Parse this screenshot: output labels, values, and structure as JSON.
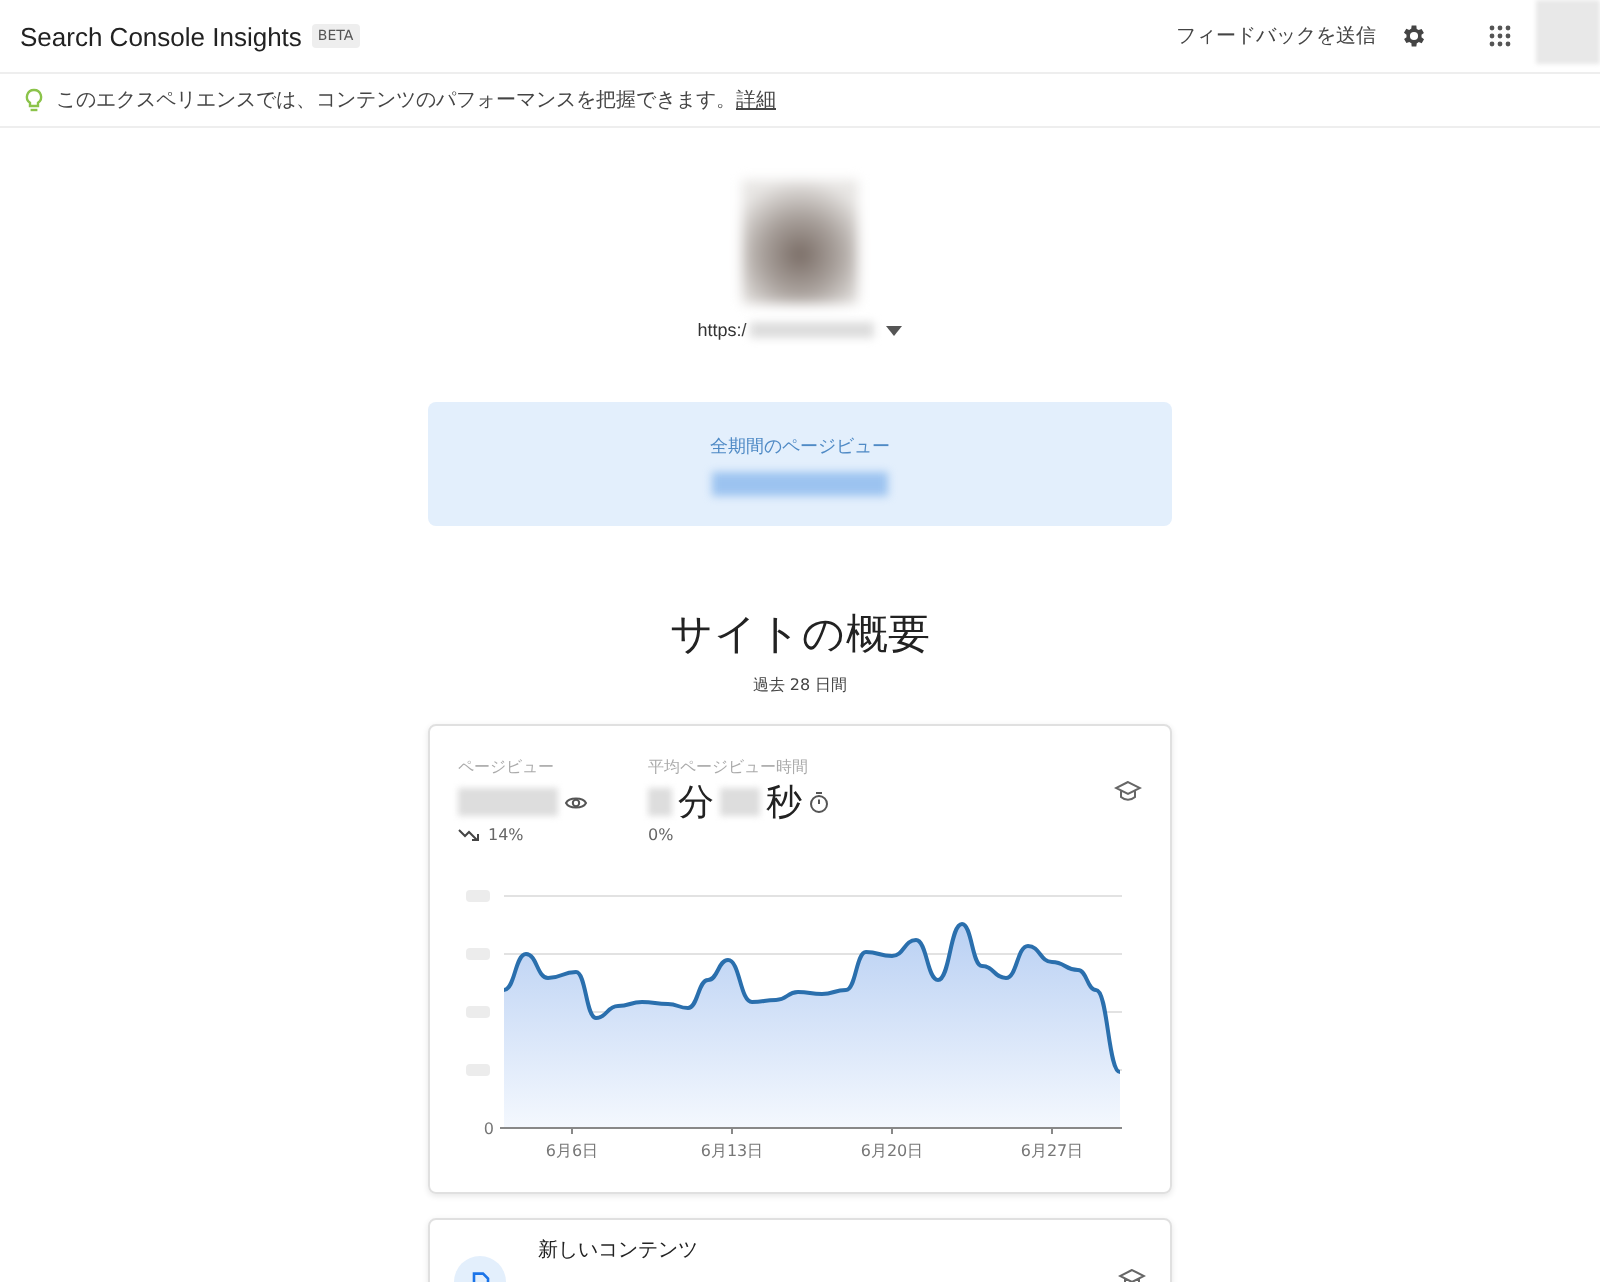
{
  "header": {
    "title": "Search Console Insights",
    "badge": "BETA",
    "feedback": "フィードバックを送信"
  },
  "banner": {
    "text": "このエクスペリエンスでは、コンテンツのパフォーマンスを把握できます。",
    "link": "詳細"
  },
  "property": {
    "url": "https:/"
  },
  "total": {
    "label": "全期間のページビュー"
  },
  "overview": {
    "title": "サイトの概要",
    "subtitle": "過去 28 日間"
  },
  "metrics": [
    {
      "label": "ページビュー",
      "kind": "count",
      "change": "14%",
      "falling": true
    },
    {
      "label": "平均ページビュー時間",
      "kind": "duration",
      "units": [
        "分",
        "秒"
      ],
      "change": "0%"
    }
  ],
  "chart": {
    "y_label": "0",
    "x_labels": [
      "6月6日",
      "6月13日",
      "6月20日",
      "6月27日"
    ]
  },
  "cards": [
    {
      "title": "新しいコンテンツ"
    }
  ]
}
